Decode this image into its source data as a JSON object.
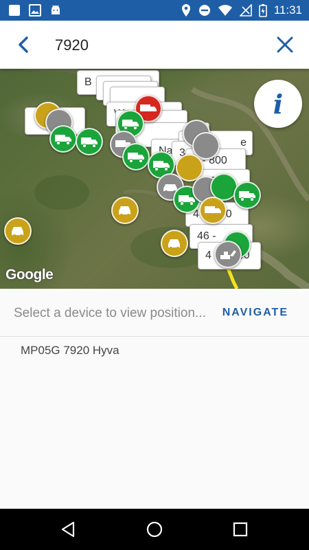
{
  "status_bar": {
    "time": "11:31"
  },
  "search": {
    "query": "7920"
  },
  "map": {
    "attribution": "Google",
    "info_label": "i",
    "labels": [
      "B",
      "W",
      "Na",
      "3",
      "e",
      "6 - 800",
      "800",
      "4",
      "00",
      "46 -",
      "4",
      "00"
    ],
    "markers": [
      {
        "color": "gold",
        "icon": "truck-icon"
      },
      {
        "color": "green",
        "icon": "truck-icon"
      },
      {
        "color": "green",
        "icon": "truck-icon"
      },
      {
        "color": "red",
        "icon": "truck-icon"
      },
      {
        "color": "green",
        "icon": "truck-icon"
      },
      {
        "color": "gray",
        "icon": "truck-icon"
      },
      {
        "color": "green",
        "icon": "truck-icon"
      },
      {
        "color": "green",
        "icon": "truck-icon"
      },
      {
        "color": "gold",
        "icon": "jeep-icon"
      },
      {
        "color": "gold",
        "icon": "jeep-icon"
      },
      {
        "color": "gray",
        "icon": "car-icon"
      },
      {
        "color": "green",
        "icon": "truck-icon"
      },
      {
        "color": "green",
        "icon": "truck-icon"
      },
      {
        "color": "gold",
        "icon": "truck-icon"
      },
      {
        "color": "gold",
        "icon": "jeep-icon"
      },
      {
        "color": "gray",
        "icon": "excavator-icon"
      }
    ]
  },
  "panel": {
    "prompt": "Select a device to view position...",
    "navigate_label": "NAVIGATE",
    "devices": [
      "MP05G 7920 Hyva"
    ]
  },
  "colors": {
    "primary": "#1e5ea6",
    "marker_green": "#1aa43a",
    "marker_gold": "#c9a21a",
    "marker_gray": "#8a8a8a",
    "marker_red": "#d6281f"
  }
}
